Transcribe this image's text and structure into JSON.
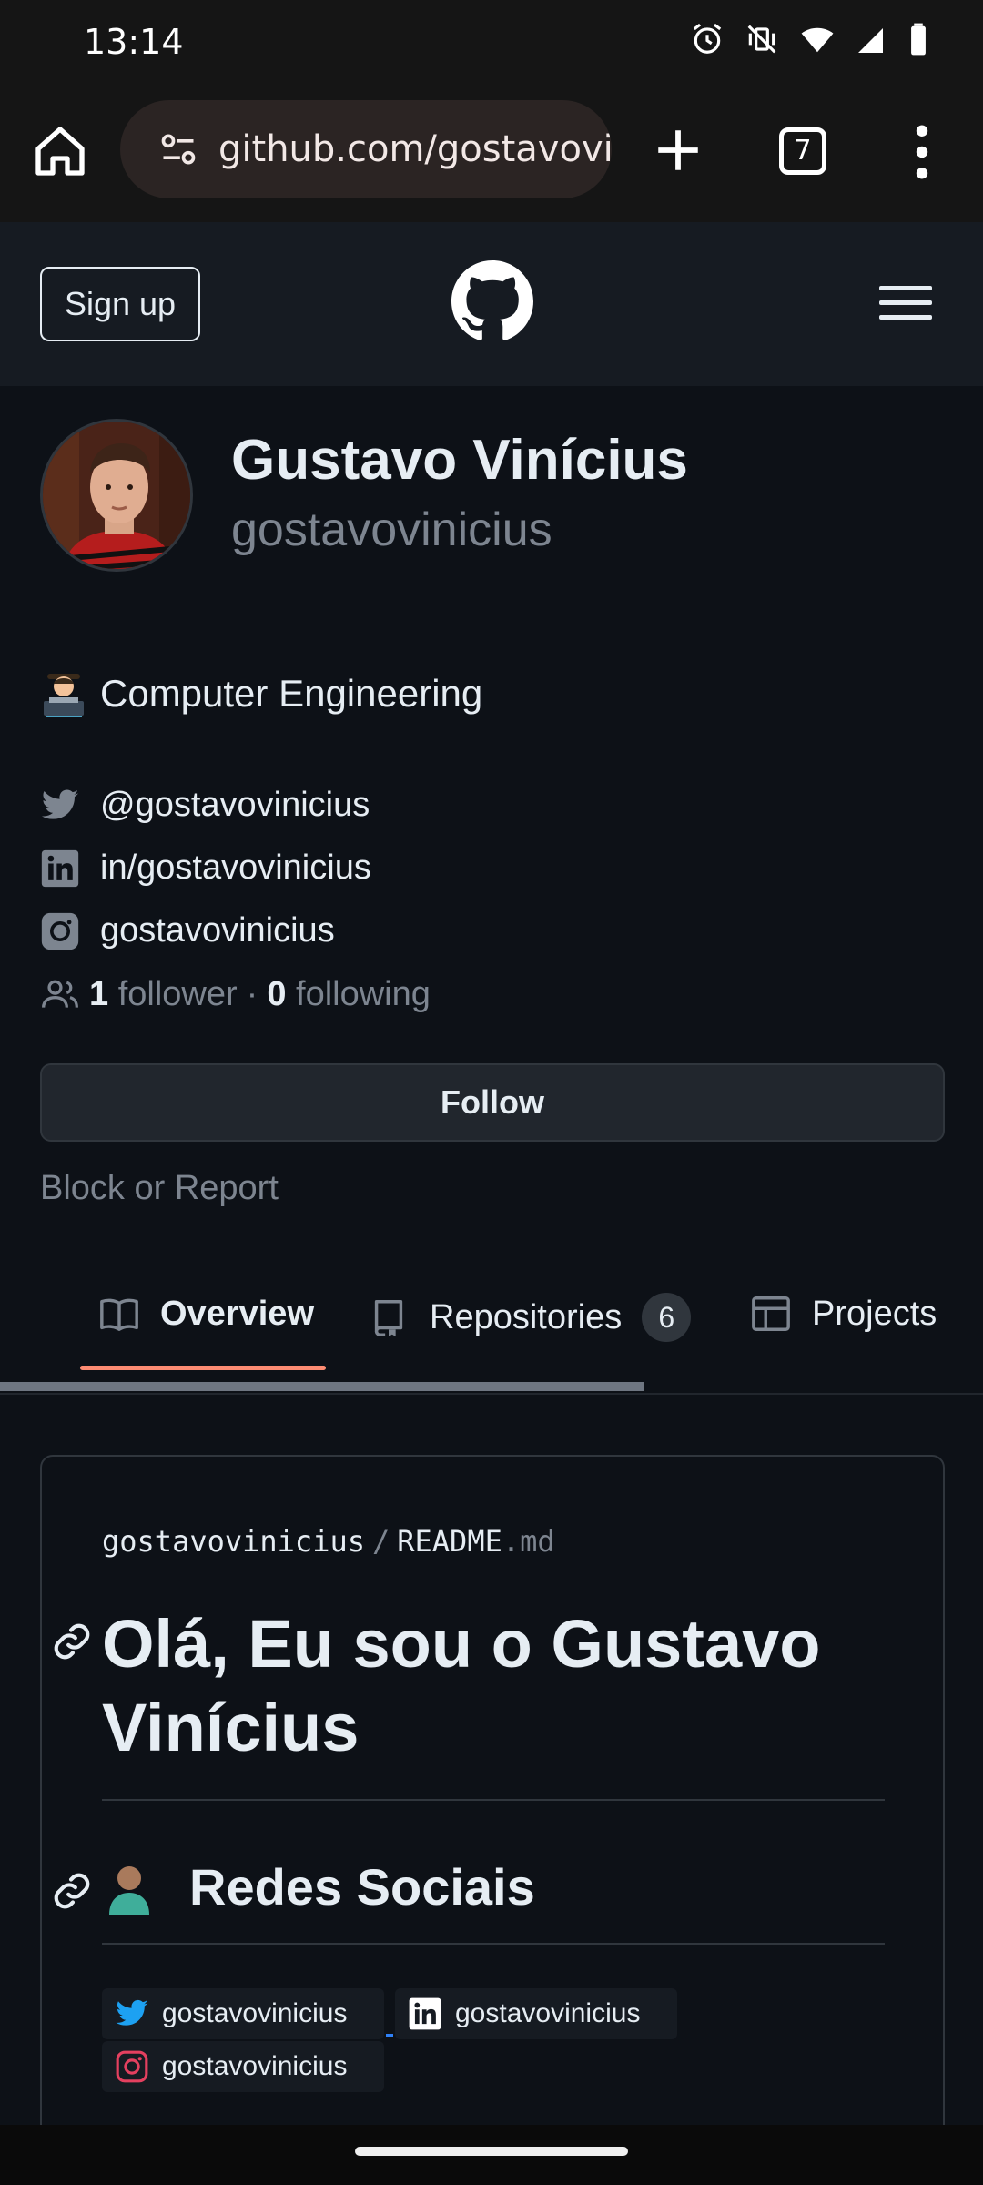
{
  "status_bar": {
    "time": "13:14",
    "icons": [
      "alarm-icon",
      "vibrate-off-icon",
      "wifi-icon",
      "cell-signal-icon",
      "battery-icon"
    ]
  },
  "browser": {
    "url": "github.com/gostavovi",
    "tab_count": "7",
    "icons": [
      "home-icon",
      "site-settings-icon",
      "new-tab-icon",
      "overflow-menu-icon"
    ]
  },
  "header": {
    "signup_label": "Sign up",
    "icons": [
      "github-logo-icon",
      "hamburger-icon"
    ]
  },
  "profile": {
    "full_name": "Gustavo Vinícius",
    "username": "gostavovinicius",
    "bio": "Computer Engineering",
    "social": [
      {
        "icon": "twitter-icon",
        "text": "@gostavovinicius"
      },
      {
        "icon": "linkedin-icon",
        "text": "in/gostavovinicius"
      },
      {
        "icon": "instagram-icon",
        "text": "gostavovinicius"
      }
    ],
    "followers_count": "1",
    "followers_label": "follower",
    "separator": "·",
    "following_count": "0",
    "following_label": "following",
    "follow_label": "Follow",
    "block_label": "Block or Report"
  },
  "tabs": [
    {
      "label": "Overview",
      "icon": "book-icon",
      "active": true
    },
    {
      "label": "Repositories",
      "icon": "repo-icon",
      "count": "6"
    },
    {
      "label": "Projects",
      "icon": "table-icon"
    }
  ],
  "readme": {
    "owner": "gostavovinicius",
    "path_separator": "/",
    "filename": "README",
    "extension": ".md",
    "heading": "Olá, Eu sou o Gustavo Vinícius",
    "subheading": "Redes Sociais",
    "badges": [
      {
        "icon": "twitter-icon",
        "label": "gostavovinicius"
      },
      {
        "icon": "linkedin-icon",
        "label": "gostavovinicius"
      },
      {
        "icon": "instagram-icon",
        "label": "gostavovinicius"
      }
    ]
  },
  "colors": {
    "background": "#0d1117",
    "header": "#161b22",
    "muted_text": "#7d8590",
    "tab_underline": "#fd8c73",
    "border": "#30363d"
  }
}
